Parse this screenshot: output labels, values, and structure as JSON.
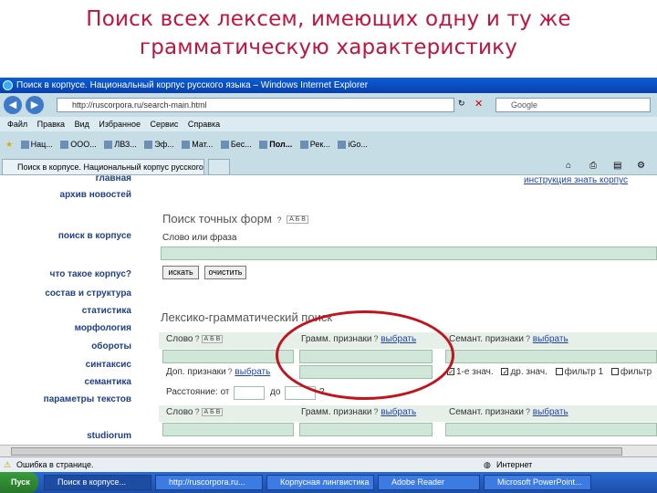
{
  "slide_title": "Поиск всех лексем, имеющих одну и ту же грамматическую характеристику",
  "window": {
    "title": "Поиск в корпусе. Национальный корпус русского языка – Windows Internet Explorer",
    "address": "http://ruscorpora.ru/search-main.html",
    "search_placeholder": "Google"
  },
  "menu": [
    "Файл",
    "Правка",
    "Вид",
    "Избранное",
    "Сервис",
    "Справка"
  ],
  "favorites": [
    "Нац...",
    "ООО...",
    "ЛВЗ...",
    "Эф...",
    "Мат...",
    "Бес...",
    "Пол...",
    "Рек...",
    "iGo..."
  ],
  "tab": {
    "label": "Поиск в корпусе. Национальный корпус русского ..."
  },
  "sidebar": {
    "items": [
      "главная",
      "архив новостей",
      "поиск в корпусе",
      "что такое корпус?",
      "состав и структура",
      "статистика",
      "морфология",
      "обороты",
      "синтаксис",
      "семантика",
      "параметры текстов",
      "studiorum"
    ]
  },
  "toplinks": "инструкция   знать корпус",
  "exact": {
    "heading": "Поиск точных форм",
    "field_label": "Слово или фраза",
    "search_button": "искать",
    "clear_button": "очистить"
  },
  "lexgram": {
    "heading": "Лексико-грамматический поиск",
    "word_label": "Слово",
    "gram_label": "Грамм. признаки",
    "sem_label": "Семант. признаки",
    "choose": "выбрать",
    "add_label": "Доп. признаки",
    "checkbox_1": "1-е знач.",
    "checkbox_2": "др. знач.",
    "checkbox_3": "фильтр 1",
    "checkbox_4": "фильтр",
    "distance_label": "Расстояние: от",
    "distance_to": "до"
  },
  "status": {
    "left": "Ошибка в странице.",
    "right": "Интернет"
  },
  "taskbar": {
    "start": "Пуск",
    "tasks": [
      "Поиск в корпусе...",
      "http://ruscorpora.ru...",
      "Корпусная лингвистика",
      "Adobe Reader",
      "Microsoft PowerPoint..."
    ]
  },
  "colors": {
    "title_red": "#c0143c",
    "sidebar_blue": "#1f3f86",
    "field_green": "#cfe6d8",
    "highlight_ellipse": "#c0141f"
  }
}
